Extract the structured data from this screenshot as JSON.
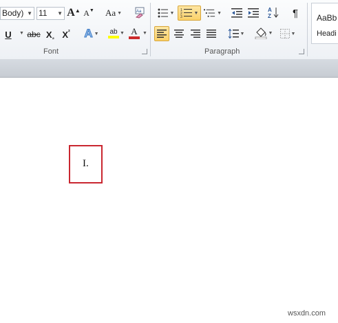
{
  "font": {
    "name_value": "Body)",
    "size_value": "11",
    "grow_label": "A",
    "shrink_label": "A",
    "case_label": "Aa",
    "underline_label": "U",
    "strike_label": "abc",
    "sub_label": "X",
    "super_label": "X",
    "effects_label": "A",
    "highlight_label": "ab",
    "color_label": "A",
    "group_label": "Font"
  },
  "paragraph": {
    "pilcrow_label": "¶",
    "sort_label": "A↓Z",
    "group_label": "Paragraph"
  },
  "styles": {
    "normal_preview": "AaBb",
    "heading_preview": "Headi"
  },
  "document": {
    "list_item": "I."
  },
  "watermark": "wsxdn.com",
  "colors": {
    "highlight_box": "#c9262f",
    "selected_button": "#fbd26a",
    "font_color_bar": "#cc2b2b",
    "highlight_color_bar": "#ffff00"
  }
}
